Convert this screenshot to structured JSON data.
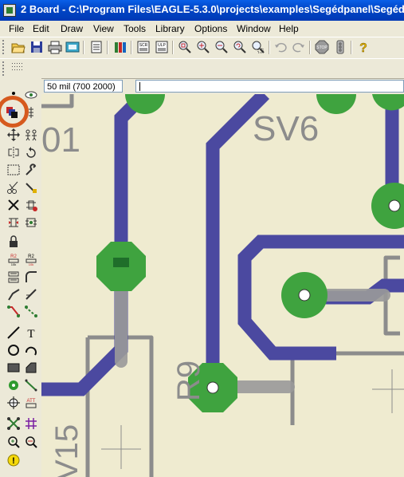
{
  "window": {
    "title": "2 Board - C:\\Program Files\\EAGLE-5.3.0\\projects\\examples\\Segédpanel\\Segédp"
  },
  "menu": {
    "items": [
      "File",
      "Edit",
      "Draw",
      "View",
      "Tools",
      "Library",
      "Options",
      "Window",
      "Help"
    ]
  },
  "toolbar": {
    "icons": [
      "open-icon",
      "save-icon",
      "print-icon",
      "cam-icon",
      "board-schematic-switch-icon",
      "library-icon",
      "script-icon",
      "ulp-icon",
      "zoom-fit-icon",
      "zoom-in-icon",
      "zoom-out-icon",
      "zoom-redraw-icon",
      "zoom-select-icon",
      "undo-icon",
      "redo-icon",
      "stop-icon",
      "go-icon",
      "help-icon"
    ]
  },
  "status": {
    "grid_readout": "50 mil (700 2000)",
    "command_value": ""
  },
  "canvas": {
    "labels": {
      "sv6": "SV6",
      "r9": "R9",
      "left_partial": "01",
      "bottom_partial": "V15"
    }
  },
  "colors": {
    "trace": "#4B49A0",
    "pad": "#3FA33F",
    "silkscreen": "#8C8C8C",
    "background": "#EFEBD0",
    "highlight": "#D65A1E"
  }
}
